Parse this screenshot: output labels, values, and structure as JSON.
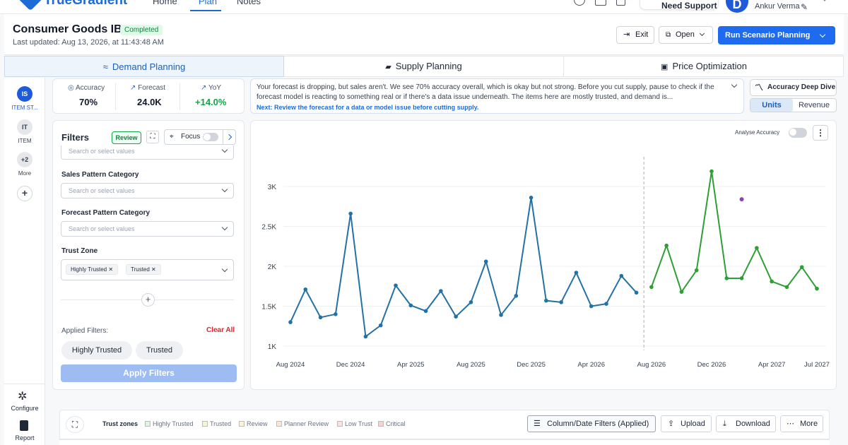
{
  "nav": {
    "logo": "TrueGradient",
    "tabs": [
      "Home",
      "Plan",
      "Notes"
    ],
    "support": "Need Support",
    "avatar_initial": "D",
    "user_name": "Ankur Verma"
  },
  "header": {
    "title": "Consumer Goods IBP",
    "status": "Completed",
    "updated": "Last updated: Aug 13, 2026, at 11:43:48 AM",
    "exit": "Exit",
    "open": "Open",
    "run": "Run Scenario Planning"
  },
  "tabs": [
    "Demand Planning",
    "Supply Planning",
    "Price Optimization"
  ],
  "rail": {
    "items": [
      {
        "badge": "IS",
        "label": "ITEM ST..."
      },
      {
        "badge": "IT",
        "label": "ITEM"
      },
      {
        "badge": "+2",
        "label": "More"
      }
    ],
    "configure": "Configure",
    "report": "Report"
  },
  "kpis": [
    {
      "label": "Accuracy",
      "value": "70%"
    },
    {
      "label": "Forecast",
      "value": "24.0K"
    },
    {
      "label": "YoY",
      "value": "+14.0%"
    }
  ],
  "insight": {
    "text": "Your forecast is dropping, but sales aren't. We see 70% accuracy overall, which is okay but not strong. Before you cut supply, pause to check if the forecast model is reacting to something real or if there's a data issue underneath. The items here are mostly trusted, and demand is...",
    "next": "Next: Review the forecast for a data or model issue before cutting supply."
  },
  "deep_dive": "Accuracy Deep Dive",
  "unit_toggle": {
    "active": "Units",
    "other": "Revenue"
  },
  "filters": {
    "title": "Filters",
    "review": "Review",
    "focus": "Focus",
    "placeholder": "Search or select values",
    "fields": [
      "Sales Pattern Category",
      "Forecast Pattern Category",
      "Trust Zone"
    ],
    "trust_chips": [
      "Highly Trusted",
      "Trusted"
    ],
    "applied_label": "Applied Filters:",
    "clear_all": "Clear All",
    "applied": [
      "Highly Trusted",
      "Trusted"
    ],
    "apply": "Apply Filters"
  },
  "analyse_accuracy": "Analyse Accuracy",
  "bottom": {
    "trust_zones_label": "Trust zones",
    "zones": [
      {
        "name": "Highly Trusted",
        "color": "#dff5e3"
      },
      {
        "name": "Trusted",
        "color": "#f3f7d6"
      },
      {
        "name": "Review",
        "color": "#fdf2d2"
      },
      {
        "name": "Planner Review",
        "color": "#fde6d4"
      },
      {
        "name": "Low Trust",
        "color": "#fde0e0"
      },
      {
        "name": "Critical",
        "color": "#fbd0d0"
      }
    ],
    "column_filters": "Column/Date Filters (Applied)",
    "upload": "Upload",
    "download": "Download",
    "more": "More"
  },
  "chart_data": {
    "type": "line",
    "x_tick_labels": [
      "Aug 2024",
      "Dec 2024",
      "Apr 2025",
      "Aug 2025",
      "Dec 2025",
      "Apr 2026",
      "Aug 2026",
      "Dec 2026",
      "Apr 2027",
      "Jul 2027"
    ],
    "y_ticks": [
      1000,
      1500,
      2000,
      2500,
      3000
    ],
    "y_tick_labels": [
      "1K",
      "1.5K",
      "2K",
      "2.5K",
      "3K"
    ],
    "ylim": [
      1000,
      3000
    ],
    "grid": true,
    "forecast_start": "Aug 2026",
    "series": [
      {
        "color": "#2471a3",
        "points": [
          [
            "Aug 2024",
            1300
          ],
          [
            "Sep 2024",
            1710
          ],
          [
            "Oct 2024",
            1360
          ],
          [
            "Nov 2024",
            1400
          ],
          [
            "Dec 2024",
            2660
          ],
          [
            "Jan 2025",
            1120
          ],
          [
            "Feb 2025",
            1260
          ],
          [
            "Mar 2025",
            1760
          ],
          [
            "Apr 2025",
            1510
          ],
          [
            "May 2025",
            1440
          ],
          [
            "Jun 2025",
            1690
          ],
          [
            "Jul 2025",
            1370
          ],
          [
            "Aug 2025",
            1550
          ],
          [
            "Sep 2025",
            2060
          ],
          [
            "Oct 2025",
            1390
          ],
          [
            "Nov 2025",
            1630
          ],
          [
            "Dec 2025",
            2860
          ],
          [
            "Jan 2026",
            1570
          ],
          [
            "Feb 2026",
            1550
          ],
          [
            "Mar 2026",
            1920
          ],
          [
            "Apr 2026",
            1500
          ],
          [
            "May 2026",
            1530
          ],
          [
            "Jun 2026",
            1880
          ],
          [
            "Jul 2026",
            1670
          ]
        ]
      },
      {
        "color": "#2e9e36",
        "points": [
          [
            "Aug 2026",
            1740
          ],
          [
            "Sep 2026",
            2260
          ],
          [
            "Oct 2026",
            1680
          ],
          [
            "Nov 2026",
            1950
          ],
          [
            "Dec 2026",
            3190
          ],
          [
            "Jan 2027",
            1850
          ],
          [
            "Feb 2027",
            1850
          ],
          [
            "Mar 2027",
            2230
          ],
          [
            "Apr 2027",
            1810
          ],
          [
            "May 2027",
            1740
          ],
          [
            "Jun 2027",
            1990
          ],
          [
            "Jul 2027",
            1720
          ]
        ]
      },
      {
        "color": "#8e44ad",
        "points": [
          [
            "Feb 2027",
            2840
          ]
        ]
      }
    ]
  }
}
